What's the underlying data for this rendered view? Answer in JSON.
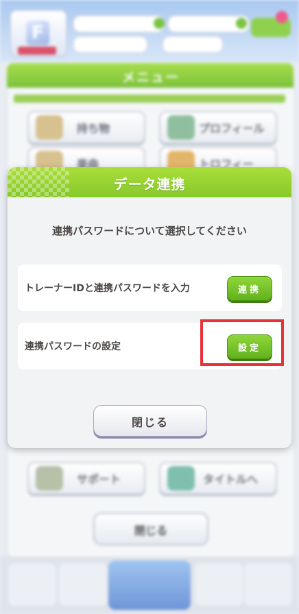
{
  "background": {
    "menu_title": "メニュー",
    "buttons": [
      "持ち物",
      "プロフィール",
      "楽曲",
      "トロフィー",
      "サポート",
      "タイトルへ"
    ],
    "close_label": "閉じる"
  },
  "dialog": {
    "title": "データ連携",
    "prompt": "連携パスワードについて選択してください",
    "rows": [
      {
        "label": "トレーナーIDと連携パスワードを入力",
        "button": "連携"
      },
      {
        "label": "連携パスワードの設定",
        "button": "設定"
      }
    ],
    "close_label": "閉じる"
  },
  "colors": {
    "accent_green": "#86c92a",
    "highlight_red": "#e8323a"
  }
}
